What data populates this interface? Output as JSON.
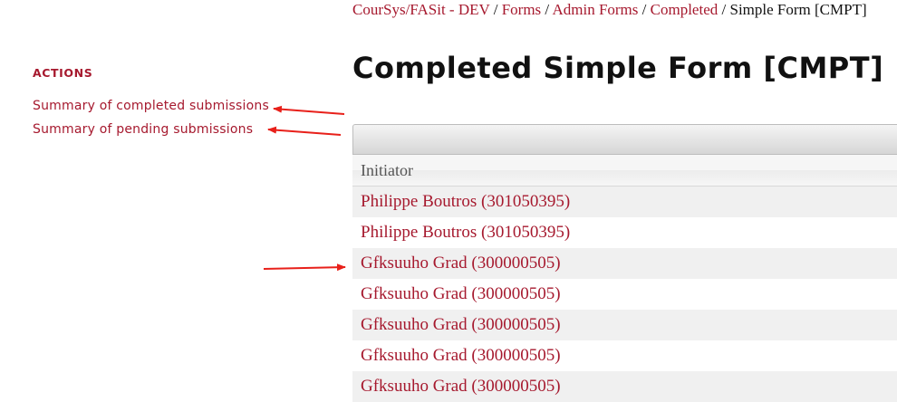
{
  "breadcrumb": [
    {
      "label": "CourSys/FASit - DEV",
      "link": true
    },
    {
      "label": "Forms",
      "link": true
    },
    {
      "label": "Admin Forms",
      "link": true
    },
    {
      "label": "Completed",
      "link": true
    },
    {
      "label": "Simple Form [CMPT]",
      "link": false
    }
  ],
  "sidebar": {
    "heading": "ACTIONS",
    "links": [
      {
        "label": "Summary of completed submissions"
      },
      {
        "label": "Summary of pending submissions"
      }
    ]
  },
  "page_title": "Completed Simple Form [CMPT]",
  "table": {
    "header": "Initiator",
    "rows": [
      "Philippe Boutros (301050395)",
      "Philippe Boutros (301050395)",
      "Gfksuuho Grad (300000505)",
      "Gfksuuho Grad (300000505)",
      "Gfksuuho Grad (300000505)",
      "Gfksuuho Grad (300000505)",
      "Gfksuuho Grad (300000505)"
    ]
  },
  "colors": {
    "link": "#a6192e",
    "annotation_arrow": "#e8201a"
  }
}
